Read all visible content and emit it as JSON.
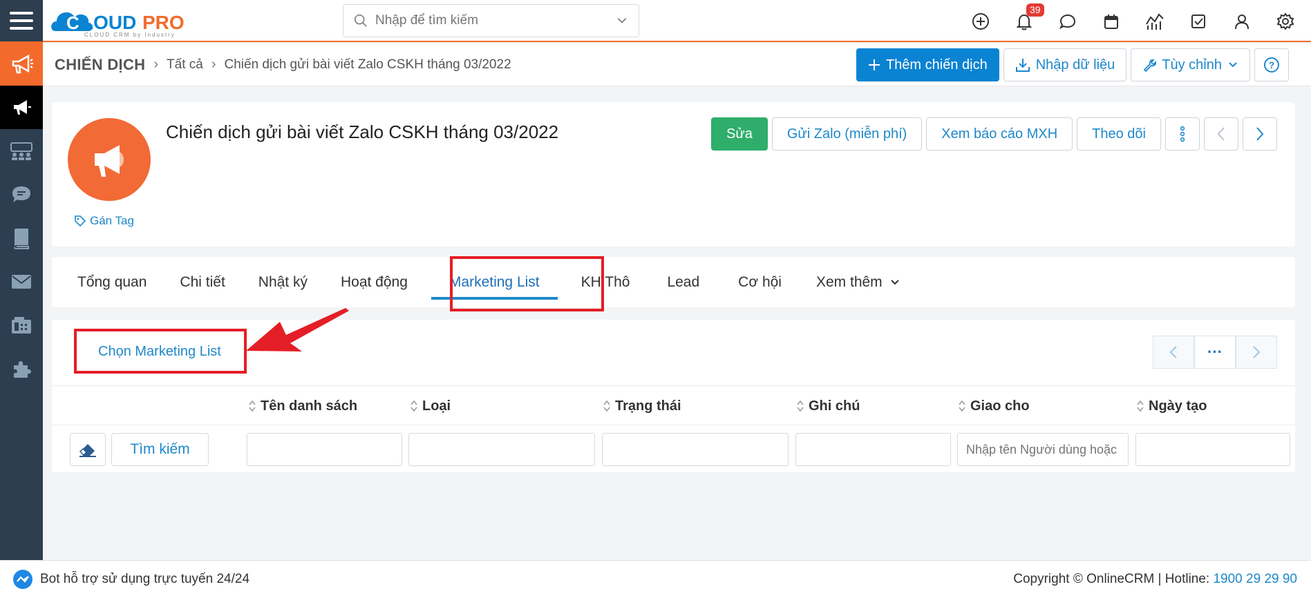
{
  "brand": {
    "name": "CLOUDPRO",
    "tagline": "CLOUD CRM by Industry",
    "color": "#f36b2c",
    "blue": "#0a83d2"
  },
  "search": {
    "placeholder": "Nhập để tìm kiếm"
  },
  "notifications": {
    "count": "39"
  },
  "breadcrumb": {
    "module": "CHIẾN DỊCH",
    "level1": "Tất cả",
    "level2": "Chiến dịch gửi bài viết Zalo CSKH tháng 03/2022"
  },
  "toolbar": {
    "add_label": "Thêm chiến dịch",
    "import_label": "Nhập dữ liệu",
    "customize_label": "Tùy chỉnh"
  },
  "record": {
    "title": "Chiến dịch gửi bài viết Zalo CSKH tháng 03/2022",
    "tag_label": "Gán Tag",
    "actions": {
      "edit": "Sửa",
      "send_zalo": "Gửi Zalo (miễn phí)",
      "report": "Xem báo cáo MXH",
      "follow": "Theo dõi"
    }
  },
  "tabs": [
    {
      "label": "Tổng quan"
    },
    {
      "label": "Chi tiết"
    },
    {
      "label": "Nhật ký"
    },
    {
      "label": "Hoạt động"
    },
    {
      "label": "Marketing List"
    },
    {
      "label": "KH Thô"
    },
    {
      "label": "Lead"
    },
    {
      "label": "Cơ hội"
    },
    {
      "label": "Xem thêm"
    }
  ],
  "list": {
    "choose_label": "Chọn Marketing List",
    "pager_more": "···",
    "columns": [
      {
        "label": "Tên danh sách"
      },
      {
        "label": "Loại"
      },
      {
        "label": "Trạng thái"
      },
      {
        "label": "Ghi chú"
      },
      {
        "label": "Giao cho"
      },
      {
        "label": "Ngày tạo"
      }
    ],
    "search_label": "Tìm kiếm",
    "assignee_placeholder": "Nhập tên Người dùng hoặc"
  },
  "footer": {
    "bot": "Bot hỗ trợ sử dụng trực tuyến 24/24",
    "copyright": "Copyright © OnlineCRM | Hotline: ",
    "hotline": "1900 29 29 90"
  }
}
